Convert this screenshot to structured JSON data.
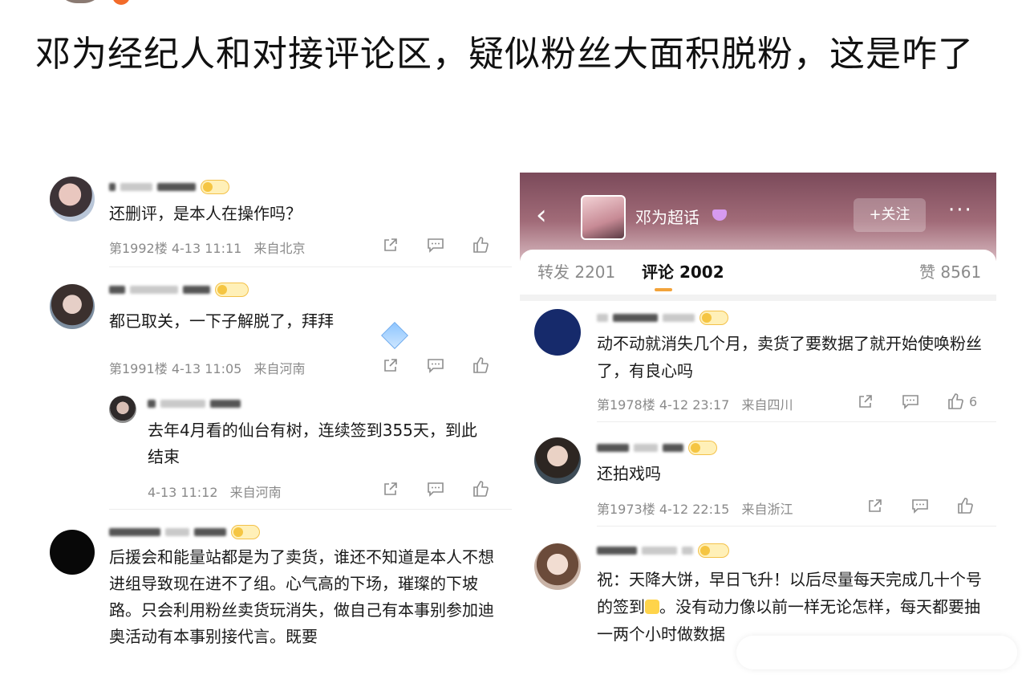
{
  "post": {
    "title": "邓为经纪人和对接评论区，疑似粉丝大面积脱粉，这是咋了"
  },
  "left_panel": {
    "comments": [
      {
        "text": "还删评，是本人在操作吗？",
        "floor": "第1992楼",
        "time": "4-13 11:11",
        "location": "来自北京"
      },
      {
        "text": "都已取关，一下子解脱了，拜拜",
        "floor": "第1991楼",
        "time": "4-13 11:05",
        "location": "来自河南"
      },
      {
        "text": "去年4月看的仙台有树，连续签到355天，到此结束",
        "floor": "",
        "time": "4-13 11:12",
        "location": "来自河南"
      },
      {
        "text": "后援会和能量站都是为了卖货，谁还不知道是本人不想进组导致现在进不了组。心气高的下场，璀璨的下坡路。只会利用粉丝卖货玩消失，做自己有本事别参加迪奥活动有本事别接代言。既要"
      }
    ]
  },
  "right_panel": {
    "header": {
      "back": "‹",
      "topic_name": "邓为超话",
      "follow_label": "+关注",
      "more": "···"
    },
    "tabs": {
      "repost": "转发 2201",
      "comments": "评论 2002",
      "likes": "赞 8561"
    },
    "comments": [
      {
        "text": "动不动就消失几个月，卖货了要数据了就开始使唤粉丝了，有良心吗",
        "floor": "第1978楼",
        "time": "4-12 23:17",
        "location": "来自四川",
        "likes": "6"
      },
      {
        "text": "还拍戏吗",
        "floor": "第1973楼",
        "time": "4-12 22:15",
        "location": "来自浙江"
      },
      {
        "text": "祝：天降大饼，早日飞升！以后尽量每天完成几十个号的签到",
        "text_cont": "。没有动力像以前一样无论怎样，每天都要抽一两个小时做数据"
      }
    ]
  },
  "icons": [
    "share-icon",
    "comment-icon",
    "like-icon",
    "back-arrow-icon",
    "more-icon",
    "gem-icon"
  ],
  "colors": {
    "badge_fill": "#fff0b8",
    "badge_border": "#f3c14a",
    "tab_underline": "#f2a33a",
    "header_gradient_top": "#7b4a5a"
  }
}
